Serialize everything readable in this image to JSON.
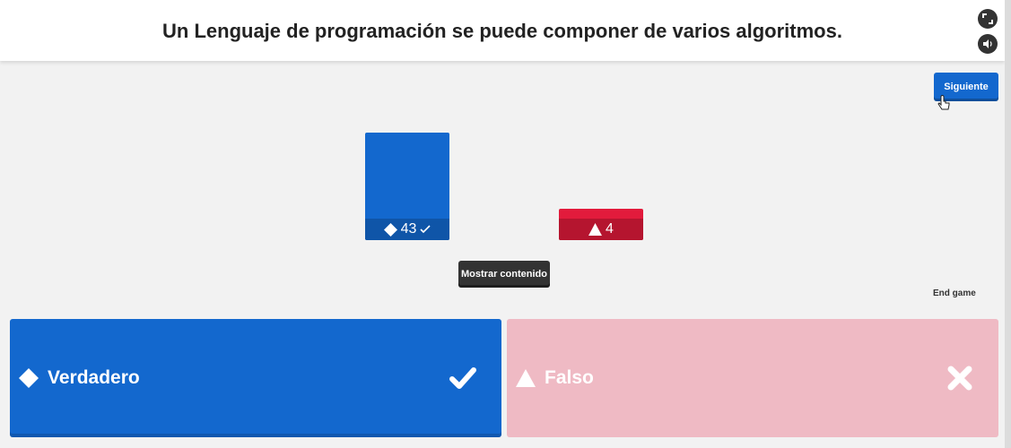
{
  "header": {
    "question": "Un Lenguaje de programación se puede componer de varios algoritmos.",
    "fullscreen_icon": "fullscreen-icon",
    "sound_icon": "volume-icon"
  },
  "controls": {
    "next_label": "Siguiente",
    "show_content_label": "Mostrar contenido",
    "end_game_label": "End game"
  },
  "results": [
    {
      "shape": "diamond",
      "count": "43",
      "correct": true,
      "color": "#1368ce"
    },
    {
      "shape": "triangle",
      "count": "4",
      "correct": false,
      "color": "#e21b3c"
    }
  ],
  "answers": [
    {
      "shape": "diamond",
      "label": "Verdadero",
      "correct": true,
      "color": "#1368ce"
    },
    {
      "shape": "triangle",
      "label": "Falso",
      "correct": false,
      "color": "#efbac4"
    }
  ]
}
